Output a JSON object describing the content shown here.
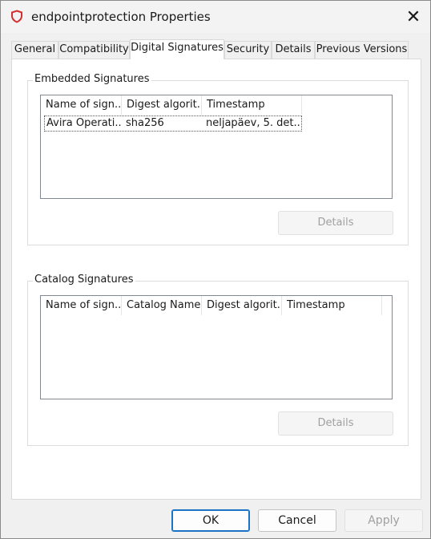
{
  "window": {
    "title": "endpointprotection Properties",
    "close_label": "✕"
  },
  "tabs": [
    {
      "label": "General"
    },
    {
      "label": "Compatibility"
    },
    {
      "label": "Digital Signatures"
    },
    {
      "label": "Security"
    },
    {
      "label": "Details"
    },
    {
      "label": "Previous Versions"
    }
  ],
  "embedded": {
    "label": "Embedded Signatures",
    "columns": [
      "Name of sign...",
      "Digest algorit...",
      "Timestamp"
    ],
    "rows": [
      {
        "name": "Avira Operati...",
        "digest": "sha256",
        "timestamp": "neljapäev, 5. det..."
      }
    ],
    "details_label": "Details"
  },
  "catalog": {
    "label": "Catalog Signatures",
    "columns": [
      "Name of sign...",
      "Catalog Name",
      "Digest algorit...",
      "Timestamp"
    ],
    "details_label": "Details"
  },
  "buttons": {
    "ok": "OK",
    "cancel": "Cancel",
    "apply": "Apply"
  },
  "colors": {
    "app_icon": "#d32f2f",
    "accent": "#1a73c4"
  }
}
